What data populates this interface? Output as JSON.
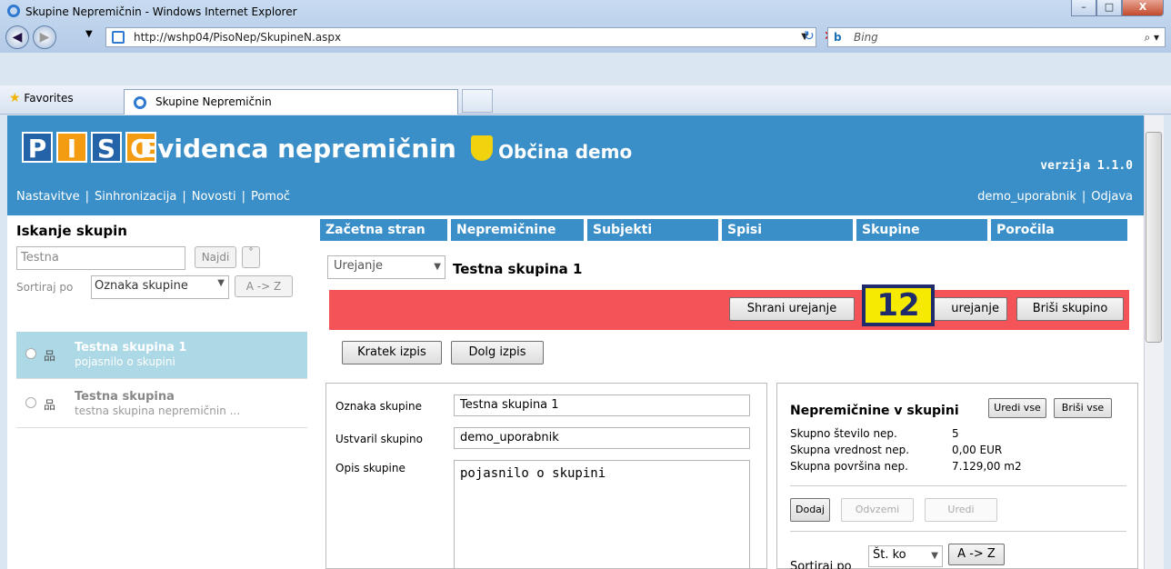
{
  "window": {
    "title": "Skupine Nepremičnin - Windows Internet Explorer"
  },
  "browser": {
    "url": "http://wshp04/PisoNep/SkupineN.aspx",
    "search_placeholder": "Bing",
    "favorites_label": "Favorites",
    "tab_title": "Skupine Nepremičnin"
  },
  "header": {
    "logo_letters": [
      "P",
      "I",
      "S",
      "O"
    ],
    "app_name": "Evidenca nepremičnin",
    "municipality": "Občina demo",
    "version": "verzija 1.1.0",
    "nav": [
      "Nastavitve",
      "Sinhronizacija",
      "Novosti",
      "Pomoč"
    ],
    "user": "demo_uporabnik",
    "logout": "Odjava"
  },
  "left": {
    "title": "Iskanje skupin",
    "search_value": "Testna",
    "search_button": "Najdi",
    "small_button": "˚",
    "sort_label": "Sortiraj po",
    "sort_value": "Oznaka skupine",
    "sort_order": "A -> Z",
    "items": [
      {
        "name": "Testna skupina 1",
        "desc": "pojasnilo o skupini"
      },
      {
        "name": "Testna skupina",
        "desc": "testna skupina nepremičnin ..."
      }
    ]
  },
  "main": {
    "tabs": [
      "Začetna stran",
      "Nepremičnine",
      "Subjekti",
      "Spisi",
      "Skupine",
      "Poročila"
    ],
    "mode_select": "Urejanje",
    "group_title": "Testna skupina 1",
    "save_button": "Shrani urejanje",
    "cancel_button": "urejanje",
    "delete_button": "Briši skupino",
    "badge": "12",
    "short_print": "Kratek izpis",
    "long_print": "Dolg izpis",
    "form": {
      "oznaka_label": "Oznaka skupine",
      "oznaka_value": "Testna skupina 1",
      "ustvaril_label": "Ustvaril skupino",
      "ustvaril_value": "demo_uporabnik",
      "opis_label": "Opis skupine",
      "opis_value": "pojasnilo o skupini"
    },
    "properties": {
      "title": "Nepremičnine v skupini",
      "edit_all": "Uredi vse",
      "delete_all": "Briši vse",
      "stats": [
        {
          "label": "Skupno število nep.",
          "value": "5"
        },
        {
          "label": "Skupna vrednost nep.",
          "value": "0,00 EUR"
        },
        {
          "label": "Skupna površina nep.",
          "value": "7.129,00 m2"
        }
      ],
      "add": "Dodaj",
      "remove": "Odvzemi",
      "edit": "Uredi",
      "sort_label": "Sortiraj po",
      "sort_value": "Št. ko",
      "sort_order": "A -> Z"
    }
  }
}
